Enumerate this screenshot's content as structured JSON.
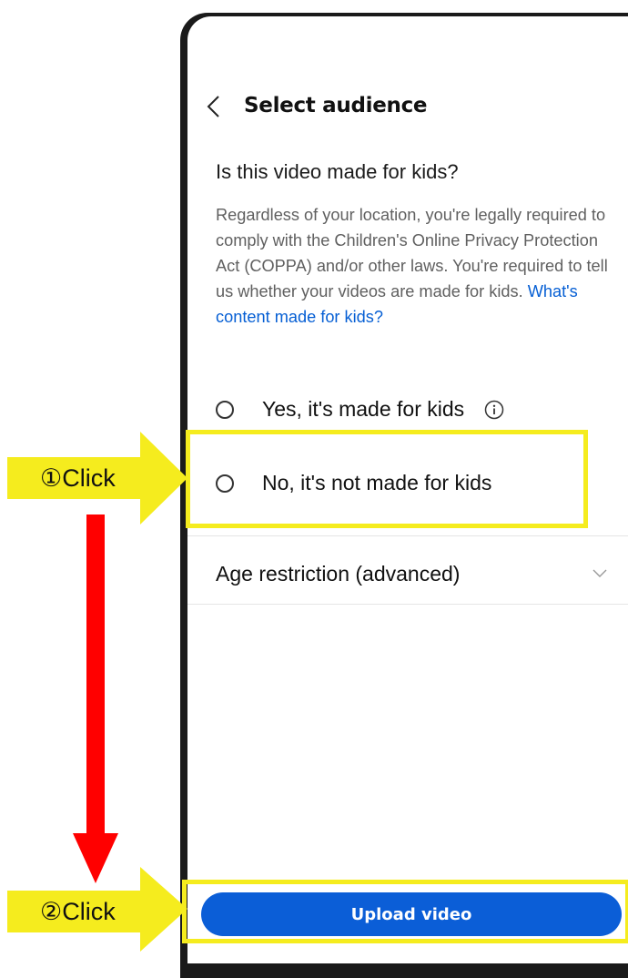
{
  "header": {
    "title": "Select audience"
  },
  "question": "Is this video made for kids?",
  "description": {
    "text": "Regardless of your location, you're legally required to comply with the Children's Online Privacy Protection Act (COPPA) and/or other laws. You're required to tell us whether your videos are made for kids. ",
    "link": "What's content made for kids?"
  },
  "options": {
    "yes": "Yes, it's made for kids",
    "no": "No, it's not made for kids"
  },
  "age_restriction": {
    "label": "Age restriction (advanced)"
  },
  "upload_button": "Upload video",
  "annotations": {
    "step1": "①Click",
    "step2": "②Click",
    "highlight_color": "#f5ec1e",
    "arrow_color": "#ff0000"
  }
}
